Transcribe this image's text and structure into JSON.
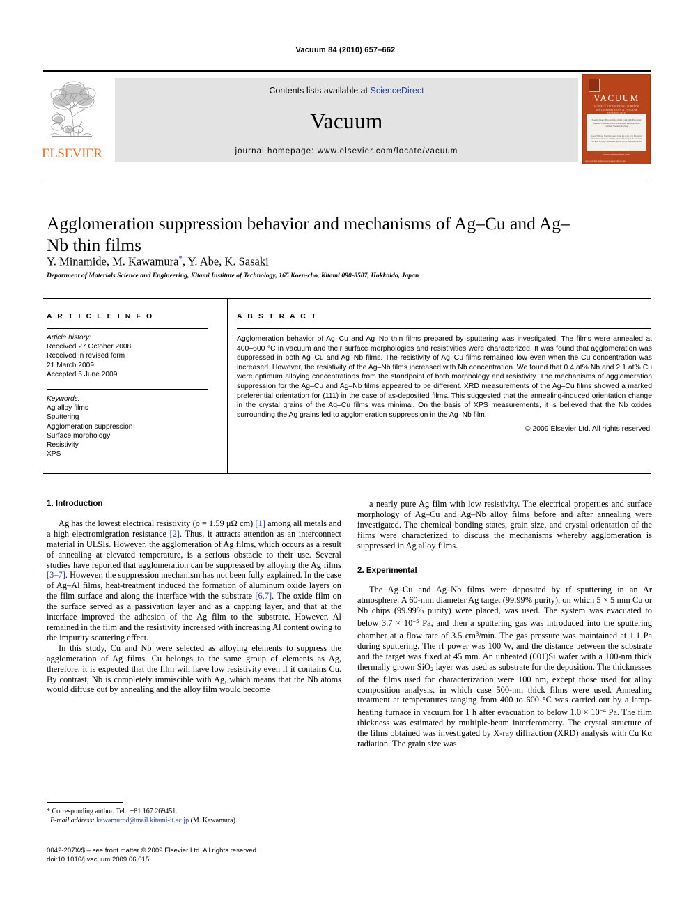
{
  "running_head": "Vacuum 84 (2010) 657–662",
  "banner": {
    "publisher_name": "ELSEVIER",
    "contents_prefix": "Contents lists available at ",
    "contents_link": "ScienceDirect",
    "journal_name": "Vacuum",
    "homepage": "journal homepage: www.elsevier.com/locate/vacuum",
    "cover": {
      "title": "VACUUM",
      "subtitle": "SURFACE ENGINEERING, SURFACE INSTRUMENTATION & VACUUM TECHNOLOGY",
      "white_line_1": "Special Issue: Proceedings of the Joint 11th European Vacuum Conference and 5th Annual Meeting of the German Vacuum Society",
      "white_line_2": "Guest Editors: Selected papers from the Joint 11th European Vacuum Conference and 5th Annual Meeting of the German Vacuum Society, Salamanca, Spain, 20–24 September 2008",
      "available_label": "Available online at",
      "sciencedirect": "ScienceDirect",
      "bottom_line": "www.sciencedirect.com",
      "corner_note": "Also available online at www.sciencedirect.com"
    }
  },
  "article": {
    "title": "Agglomeration suppression behavior and mechanisms of Ag–Cu and Ag–Nb thin films",
    "authors_pre": "Y. Minamide, M. Kawamura",
    "authors_post": ", Y. Abe, K. Sasaki",
    "author_star": "*",
    "affiliation": "Department of Materials Science and Engineering, Kitami Institute of Technology, 165 Koen-cho, Kitami 090-8507, Hokkaido, Japan"
  },
  "info_panel": {
    "heading": "A R T I C L E  I N F O",
    "history_label": "Article history:",
    "history": [
      "Received 27 October 2008",
      "Received in revised form",
      "21 March 2009",
      "Accepted 5 June 2009"
    ],
    "keywords_label": "Keywords:",
    "keywords": [
      "Ag alloy films",
      "Sputtering",
      "Agglomeration suppression",
      "Surface morphology",
      "Resistivity",
      "XPS"
    ]
  },
  "abstract_panel": {
    "heading": "A B S T R A C T",
    "text": "Agglomeration behavior of Ag–Cu and Ag–Nb thin films prepared by sputtering was investigated. The films were annealed at 400–600 °C in vacuum and their surface morphologies and resistivities were characterized. It was found that agglomeration was suppressed in both Ag–Cu and Ag–Nb films. The resistivity of Ag–Cu films remained low even when the Cu concentration was increased. However, the resistivity of the Ag–Nb films increased with Nb concentration. We found that 0.4 at% Nb and 2.1 at% Cu were optimum alloying concentrations from the standpoint of both morphology and resistivity. The mechanisms of agglomeration suppression for the Ag–Cu and Ag–Nb films appeared to be different. XRD measurements of the Ag–Cu films showed a marked preferential orientation for (111) in the case of as-deposited films. This suggested that the annealing-induced orientation change in the crystal grains of the Ag–Cu films was minimal. On the basis of XPS measurements, it is believed that the Nb oxides surrounding the Ag grains led to agglomeration suppression in the Ag–Nb film.",
    "copyright": "© 2009 Elsevier Ltd. All rights reserved."
  },
  "sections": {
    "intro_heading": "1.  Introduction",
    "experimental_heading": "2.  Experimental"
  },
  "body": {
    "left_p1_a": "Ag has the lowest electrical resistivity (",
    "left_p1_rho": "ρ",
    "left_p1_b": " = 1.59 μΩ cm) ",
    "left_p1_ref1": "[1]",
    "left_p1_c": " among all metals and a high electromigration resistance ",
    "left_p1_ref2": "[2]",
    "left_p1_d": ". Thus, it attracts attention as an interconnect material in ULSIs. However, the agglomeration of Ag films, which occurs as a result of annealing at elevated temperature, is a serious obstacle to their use. Several studies have reported that agglomeration can be suppressed by alloying the Ag films ",
    "left_p1_ref3": "[3–7]",
    "left_p1_e": ". However, the suppression mechanism has not been fully explained. In the case of Ag–Al films, heat-treatment induced the formation of aluminum oxide layers on the film surface and along the interface with the substrate ",
    "left_p1_ref4": "[6,7]",
    "left_p1_f": ". The oxide film on the surface served as a passivation layer and as a capping layer, and that at the interface improved the adhesion of the Ag film to the substrate. However, Al remained in the film and the resistivity increased with increasing Al content owing to the impurity scattering effect.",
    "left_p2": "In this study, Cu and Nb were selected as alloying elements to suppress the agglomeration of Ag films. Cu belongs to the same group of elements as Ag, therefore, it is expected that the film will have low resistivity even if it contains Cu. By contrast, Nb is completely immiscible with Ag, which means that the Nb atoms would diffuse out by annealing and the alloy film would become",
    "right_p1": "a nearly pure Ag film with low resistivity. The electrical properties and surface morphology of Ag–Cu and Ag–Nb alloy films before and after annealing were investigated. The chemical bonding states, grain size, and crystal orientation of the films were characterized to discuss the mechanisms whereby agglomeration is suppressed in Ag alloy films.",
    "right_exp_a": "The Ag–Cu and Ag–Nb films were deposited by rf sputtering in an Ar atmosphere. A 60-mm diameter Ag target (99.99% purity), on which 5 × 5 mm Cu or Nb chips (99.99% purity) were placed, was used. The system was evacuated to below 3.7 × 10",
    "right_exp_sup1": "−5",
    "right_exp_b": " Pa, and then a sputtering gas was introduced into the sputtering chamber at a flow rate of 3.5 cm",
    "right_exp_sup2": "3",
    "right_exp_c": "/min. The gas pressure was maintained at 1.1 Pa during sputtering. The rf power was 100 W, and the distance between the substrate and the target was fixed at 45 mm. An unheated (001)Si wafer with a 100-nm thick thermally grown SiO",
    "right_exp_sub1": "2",
    "right_exp_d": " layer was used as substrate for the deposition. The thicknesses of the films used for characterization were 100 nm, except those used for alloy composition analysis, in which case 500-nm thick films were used. Annealing treatment at temperatures ranging from 400 to 600 °C was carried out by a lamp-heating furnace in vacuum for 1 h after evacuation to below 1.0 × 10",
    "right_exp_sup3": "−4",
    "right_exp_e": " Pa. The film thickness was estimated by multiple-beam interferometry. The crystal structure of the films obtained was investigated by X-ray diffraction (XRD) analysis with Cu Kα radiation. The grain size was"
  },
  "footnotes": {
    "corresponding": "* Corresponding author. Tel.: +81 167 269451.",
    "email_label": "E-mail address:",
    "email": "kawamurod@mail.kitami-it.ac.jp",
    "email_suffix": " (M. Kawamura)."
  },
  "imprint": {
    "line1": "0042-207X/$ – see front matter © 2009 Elsevier Ltd. All rights reserved.",
    "line2": "doi:10.1016/j.vacuum.2009.06.015"
  },
  "colors": {
    "link": "#2b3fa0",
    "elsevier_orange": "#E8742C",
    "cover_rust": "#B8441C",
    "panel_grey": "#e3e3e3"
  }
}
